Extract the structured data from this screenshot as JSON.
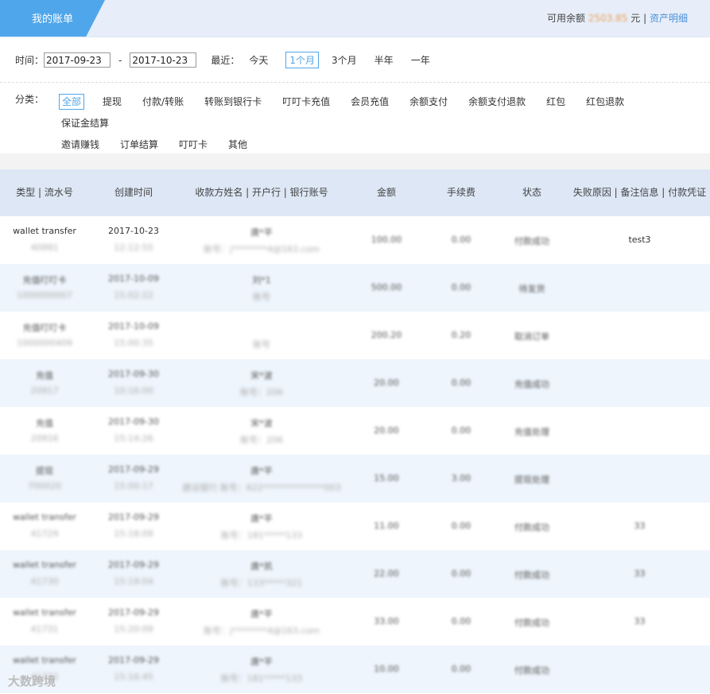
{
  "header": {
    "tab_title": "我的账单",
    "balance_label": "可用余额",
    "balance_amount": "2503.85",
    "balance_unit": "元",
    "divider": "|",
    "asset_link": "资产明细"
  },
  "filters": {
    "time_label": "时间：",
    "date_from": "2017-09-23",
    "date_to": "2017-10-23",
    "date_sep": "-",
    "recent_label": "最近：",
    "recent_options": [
      "今天",
      "1个月",
      "3个月",
      "半年",
      "一年"
    ],
    "recent_selected": "1个月",
    "category_label": "分类：",
    "categories": [
      "全部",
      "提现",
      "付款/转账",
      "转账到银行卡",
      "叮叮卡充值",
      "会员充值",
      "余额支付",
      "余额支付退款",
      "红包",
      "红包退款",
      "保证金结算",
      "邀请赚钱",
      "订单结算",
      "叮叮卡",
      "其他"
    ],
    "category_selected": "全部"
  },
  "table": {
    "headers": [
      "类型 | 流水号",
      "创建时间",
      "收款方姓名 | 开户行 | 银行账号",
      "金额",
      "手续费",
      "状态",
      "失败原因 | 备注信息 | 付款凭证"
    ],
    "rows": [
      {
        "type": "wallet transfer",
        "serial": "40991",
        "date": "2017-10-23",
        "time": "12:12:55",
        "name": "唐*平",
        "account": "账号：j********4@163.com",
        "amount": "100.00",
        "fee": "0.00",
        "status": "付款成功",
        "note": "test3"
      },
      {
        "type": "充值叮叮卡",
        "serial": "1000000007",
        "date": "2017-10-09",
        "time": "15:02:22",
        "name": "刘*1",
        "account": "账号",
        "amount": "500.00",
        "fee": "0.00",
        "status": "待发货",
        "note": ""
      },
      {
        "type": "充值叮叮卡",
        "serial": "1000000409",
        "date": "2017-10-09",
        "time": "15:00:35",
        "name": "",
        "account": "账号",
        "amount": "200.20",
        "fee": "0.20",
        "status": "取消订单",
        "note": ""
      },
      {
        "type": "充值",
        "serial": "20917",
        "date": "2017-09-30",
        "time": "10:16:00",
        "name": "宋*波",
        "account": "账号：206",
        "amount": "20.00",
        "fee": "0.00",
        "status": "充值成功",
        "note": ""
      },
      {
        "type": "充值",
        "serial": "20916",
        "date": "2017-09-30",
        "time": "15:14:26",
        "name": "宋*波",
        "account": "账号：206",
        "amount": "20.00",
        "fee": "0.00",
        "status": "充值处理",
        "note": ""
      },
      {
        "type": "提现",
        "serial": "700020",
        "date": "2017-09-29",
        "time": "15:00:17",
        "name": "唐*平",
        "account": "建设银行 账号：622**************003",
        "amount": "15.00",
        "fee": "3.00",
        "status": "提现处理",
        "note": ""
      },
      {
        "type": "wallet transfer",
        "serial": "41729",
        "date": "2017-09-29",
        "time": "15:18:09",
        "name": "唐*平",
        "account": "账号：181*****133",
        "amount": "11.00",
        "fee": "0.00",
        "status": "付款成功",
        "note": "33"
      },
      {
        "type": "wallet transfer",
        "serial": "41730",
        "date": "2017-09-29",
        "time": "15:19:04",
        "name": "唐*凯",
        "account": "账号：133*****321",
        "amount": "22.00",
        "fee": "0.00",
        "status": "付款成功",
        "note": "33"
      },
      {
        "type": "wallet transfer",
        "serial": "41731",
        "date": "2017-09-29",
        "time": "15:20:09",
        "name": "唐*平",
        "account": "账号：j********4@163.com",
        "amount": "33.00",
        "fee": "0.00",
        "status": "付款成功",
        "note": "33"
      },
      {
        "type": "wallet transfer",
        "serial": "41732",
        "date": "2017-09-29",
        "time": "15:16:45",
        "name": "唐*平",
        "account": "账号：181*****133",
        "amount": "10.00",
        "fee": "0.00",
        "status": "付款成功",
        "note": ""
      }
    ]
  },
  "watermark": "大数跨境",
  "colors": {
    "accent": "#4fa6ea",
    "header_bg": "#dde7f5",
    "alt_row": "#eef5fc",
    "balance": "#f0a05a"
  }
}
